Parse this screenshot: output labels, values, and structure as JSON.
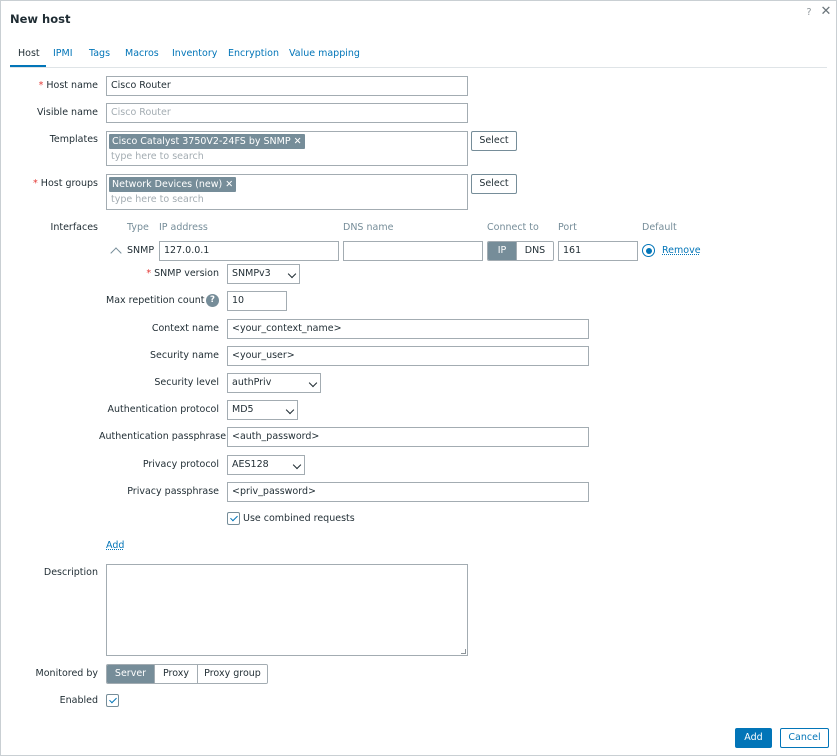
{
  "dialog": {
    "title": "New host",
    "help_label": "?",
    "close_label": "✕"
  },
  "tabs": [
    "Host",
    "IPMI",
    "Tags",
    "Macros",
    "Inventory",
    "Encryption",
    "Value mapping"
  ],
  "form": {
    "host_name": {
      "label": "Host name",
      "required_mark": "*",
      "value": "Cisco Router"
    },
    "visible_name": {
      "label": "Visible name",
      "placeholder": "Cisco Router"
    },
    "templates": {
      "label": "Templates",
      "chip": "Cisco Catalyst 3750V2-24FS by SNMP",
      "chip_remove": "✕",
      "placeholder": "type here to search",
      "select_label": "Select"
    },
    "host_groups": {
      "label": "Host groups",
      "required_mark": "*",
      "chip": "Network Devices (new)",
      "chip_remove": "✕",
      "placeholder": "type here to search",
      "select_label": "Select"
    }
  },
  "interfaces": {
    "label": "Interfaces",
    "headers": {
      "type": "Type",
      "ip": "IP address",
      "dns": "DNS name",
      "connect": "Connect to",
      "port": "Port",
      "default": "Default"
    },
    "row": {
      "type": "SNMP",
      "ip": "127.0.0.1",
      "dns": "",
      "connect_ip": "IP",
      "connect_dns": "DNS",
      "port": "161",
      "remove_label": "Remove"
    },
    "snmp": {
      "version": {
        "label": "SNMP version",
        "required_mark": "*",
        "value": "SNMPv3"
      },
      "max_repetition": {
        "label": "Max repetition count",
        "help": "?",
        "value": "10"
      },
      "context_name": {
        "label": "Context name",
        "value": "<your_context_name>"
      },
      "security_name": {
        "label": "Security name",
        "value": "<your_user>"
      },
      "security_level": {
        "label": "Security level",
        "value": "authPriv"
      },
      "auth_protocol": {
        "label": "Authentication protocol",
        "value": "MD5"
      },
      "auth_passphrase": {
        "label": "Authentication passphrase",
        "value": "<auth_password>"
      },
      "privacy_protocol": {
        "label": "Privacy protocol",
        "value": "AES128"
      },
      "privacy_passphrase": {
        "label": "Privacy passphrase",
        "value": "<priv_password>"
      },
      "combined_requests": {
        "label": "Use combined requests",
        "checked": true
      }
    },
    "add_label": "Add"
  },
  "description": {
    "label": "Description",
    "value": ""
  },
  "monitored_by": {
    "label": "Monitored by",
    "options": [
      "Server",
      "Proxy",
      "Proxy group"
    ],
    "selected": "Server"
  },
  "enabled": {
    "label": "Enabled",
    "checked": true
  },
  "footer": {
    "add_label": "Add",
    "cancel_label": "Cancel"
  },
  "colors": {
    "accent": "#0275b8",
    "chip": "#768d99",
    "required": "#e33734"
  }
}
